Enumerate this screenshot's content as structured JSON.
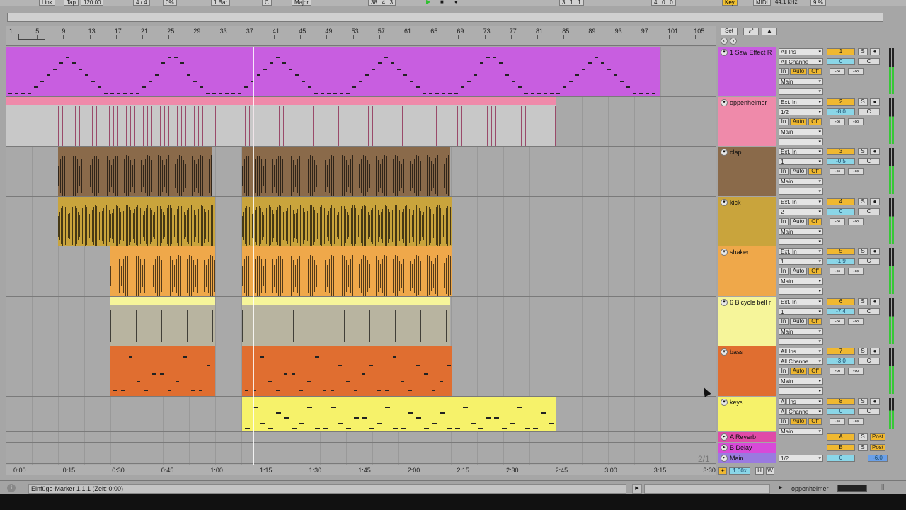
{
  "transport": {
    "link": "Link",
    "tap": "Tap",
    "tempo": "120.00",
    "signature": "4 / 4",
    "groove": "0%",
    "quantize": "1 Bar",
    "key": "C",
    "scale": "Major",
    "position": "38 .  4 .  3",
    "loop_start": "3 .  1 .  1",
    "loop_length": "4 .  0 .  0",
    "key_map": "Key",
    "midi_map": "MIDI",
    "sample_rate": "44.1 kHz",
    "cpu": "9 %"
  },
  "ruler": {
    "bars": [
      "1",
      "5",
      "9",
      "13",
      "17",
      "21",
      "25",
      "29",
      "33",
      "37",
      "41",
      "45",
      "49",
      "53",
      "57",
      "61",
      "65",
      "69",
      "73",
      "77",
      "81",
      "85",
      "89",
      "93",
      "97",
      "101",
      "105"
    ]
  },
  "time": {
    "labels": [
      "0:00",
      "0:15",
      "0:30",
      "0:45",
      "1:00",
      "1:15",
      "1:30",
      "1:45",
      "2:00",
      "2:15",
      "2:30",
      "2:45",
      "3:00",
      "3:15",
      "3:30"
    ],
    "counter": "2/1"
  },
  "set_button": "Set",
  "tracks": [
    {
      "name": "1 Saw Effect R",
      "color": "#c85ee0",
      "input": "All Ins",
      "channel": "All Channe",
      "in": "In",
      "auto": "Auto",
      "off": "Off",
      "out": "Main",
      "num": "1",
      "vol": "0",
      "pan": "C",
      "s": "S",
      "sends": "-∞",
      "sends2": "-∞",
      "auto_on": true
    },
    {
      "name": "oppenheimer",
      "color": "#ef8aaa",
      "input": "Ext. In",
      "channel": "1/2",
      "in": "In",
      "auto": "Auto",
      "off": "Off",
      "out": "Main",
      "num": "2",
      "vol": "-8.0",
      "pan": "C",
      "s": "S",
      "sends": "-∞",
      "sends2": "-∞",
      "auto_on": true
    },
    {
      "name": "clap",
      "color": "#8a6a4a",
      "input": "Ext. In",
      "channel": "1",
      "in": "In",
      "auto": "Auto",
      "off": "Off",
      "out": "Main",
      "num": "3",
      "vol": "-0.5",
      "pan": "C",
      "s": "S",
      "sends": "-∞",
      "sends2": "-∞",
      "auto_on": false
    },
    {
      "name": "kick",
      "color": "#c9a43c",
      "input": "Ext. In",
      "channel": "2",
      "in": "In",
      "auto": "Auto",
      "off": "Off",
      "out": "Main",
      "num": "4",
      "vol": "0",
      "pan": "C",
      "s": "S",
      "sends": "-∞",
      "sends2": "-∞",
      "auto_on": false
    },
    {
      "name": "shaker",
      "color": "#efa84a",
      "input": "Ext. In",
      "channel": "1",
      "in": "In",
      "auto": "Auto",
      "off": "Off",
      "out": "Main",
      "num": "5",
      "vol": "-1.9",
      "pan": "C",
      "s": "S",
      "sends": "-∞",
      "sends2": "-∞",
      "auto_on": false
    },
    {
      "name": "6 Bicycle bell r",
      "color": "#f6f59a",
      "input": "Ext. In",
      "channel": "1",
      "in": "In",
      "auto": "Auto",
      "off": "Off",
      "out": "Main",
      "num": "6",
      "vol": "-7.4",
      "pan": "C",
      "s": "S",
      "sends": "-∞",
      "sends2": "-∞",
      "auto_on": false
    },
    {
      "name": "bass",
      "color": "#e06e30",
      "input": "All Ins",
      "channel": "All Channe",
      "in": "In",
      "auto": "Auto",
      "off": "Off",
      "out": "Main",
      "num": "7",
      "vol": "-3.0",
      "pan": "C",
      "s": "S",
      "sends": "-∞",
      "sends2": "-∞",
      "auto_on": true
    },
    {
      "name": "keys",
      "color": "#f6f26a",
      "input": "All Ins",
      "channel": "All Channe",
      "in": "In",
      "auto": "Auto",
      "off": "Off",
      "out": "Main",
      "num": "8",
      "vol": "0",
      "pan": "C",
      "s": "S",
      "sends": "-∞",
      "sends2": "-∞",
      "auto_on": true
    }
  ],
  "returns": [
    {
      "name": "A Reverb",
      "color": "#e04aa8",
      "letter": "A",
      "s": "S",
      "post": "Post"
    },
    {
      "name": "B Delay",
      "color": "#d84ad8",
      "letter": "B",
      "s": "S",
      "post": "Post"
    }
  ],
  "main": {
    "name": "Main",
    "color": "#9a7ae0",
    "out": "1/2",
    "vol": "0",
    "master_vol": "-6.0"
  },
  "zoom": "1.00x",
  "h": "H",
  "w": "W",
  "status": {
    "message": "Einfüge-Marker 1.1.1 (Zeit: 0:00)",
    "selected_track": "oppenheimer"
  }
}
